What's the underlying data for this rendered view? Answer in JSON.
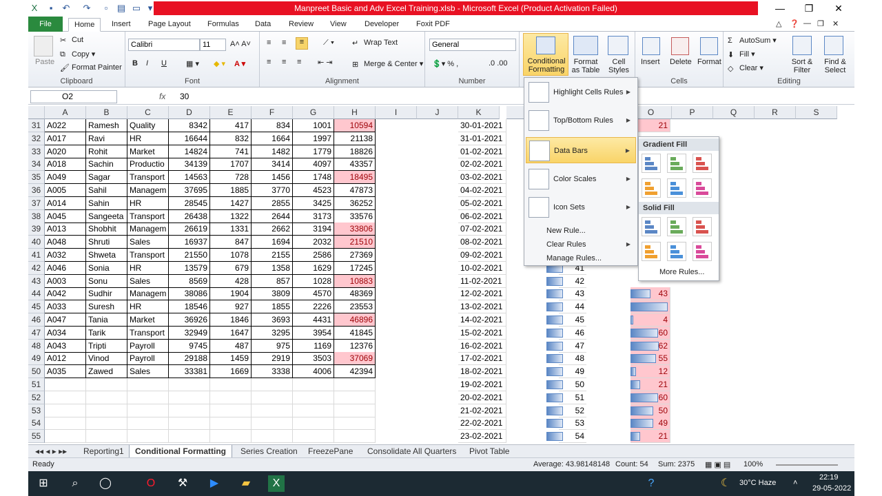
{
  "window": {
    "title": "Manpreet Basic and Adv Excel Training.xlsb - Microsoft Excel (Product Activation Failed)"
  },
  "tabs": [
    "File",
    "Home",
    "Insert",
    "Page Layout",
    "Formulas",
    "Data",
    "Review",
    "View",
    "Developer",
    "Foxit PDF"
  ],
  "ribbon": {
    "clipboard": {
      "paste": "Paste",
      "cut": "Cut",
      "copy": "Copy",
      "painter": "Format Painter",
      "label": "Clipboard"
    },
    "font": {
      "name": "Calibri",
      "size": "11",
      "label": "Font",
      "bold": "B",
      "italic": "I",
      "underline": "U"
    },
    "alignment": {
      "wrap": "Wrap Text",
      "merge": "Merge & Center",
      "label": "Alignment"
    },
    "number": {
      "format": "General",
      "label": "Number"
    },
    "styles": {
      "cf": "Conditional Formatting",
      "fat": "Format as Table",
      "cs": "Cell Styles"
    },
    "cells": {
      "insert": "Insert",
      "delete": "Delete",
      "format": "Format",
      "label": "Cells"
    },
    "editing": {
      "autosum": "AutoSum",
      "fill": "Fill",
      "clear": "Clear",
      "sort": "Sort & Filter",
      "find": "Find & Select",
      "label": "Editing"
    }
  },
  "formula": {
    "namebox": "O2",
    "fx": "fx",
    "value": "30"
  },
  "columns": [
    "A",
    "B",
    "C",
    "D",
    "E",
    "F",
    "G",
    "H",
    "I",
    "J",
    "K",
    "L",
    "M",
    "N",
    "O",
    "P",
    "Q",
    "R",
    "S"
  ],
  "rows": [
    [
      "31",
      "A022",
      "Ramesh",
      "Quality",
      "8342",
      "417",
      "834",
      "1001",
      "10594",
      "30-01-2021",
      "",
      "",
      ""
    ],
    [
      "32",
      "A017",
      "Ravi",
      "HR",
      "16644",
      "832",
      "1664",
      "1997",
      "21138",
      "31-01-2021",
      "",
      "",
      ""
    ],
    [
      "33",
      "A020",
      "Rohit",
      "Market",
      "14824",
      "741",
      "1482",
      "1779",
      "18826",
      "01-02-2021",
      "",
      "",
      ""
    ],
    [
      "34",
      "A018",
      "Sachin",
      "Productio",
      "34139",
      "1707",
      "3414",
      "4097",
      "43357",
      "02-02-2021",
      "",
      "",
      ""
    ],
    [
      "35",
      "A049",
      "Sagar",
      "Transport",
      "14563",
      "728",
      "1456",
      "1748",
      "18495",
      "03-02-2021",
      "",
      "",
      ""
    ],
    [
      "36",
      "A005",
      "Sahil",
      "Managem",
      "37695",
      "1885",
      "3770",
      "4523",
      "47873",
      "04-02-2021",
      "",
      "",
      ""
    ],
    [
      "37",
      "A014",
      "Sahin",
      "HR",
      "28545",
      "1427",
      "2855",
      "3425",
      "36252",
      "05-02-2021",
      "",
      "",
      ""
    ],
    [
      "38",
      "A045",
      "Sangeeta",
      "Transport",
      "26438",
      "1322",
      "2644",
      "3173",
      "33576",
      "06-02-2021",
      "",
      "",
      ""
    ],
    [
      "39",
      "A013",
      "Shobhit",
      "Managem",
      "26619",
      "1331",
      "2662",
      "3194",
      "33806",
      "07-02-2021",
      "",
      "",
      ""
    ],
    [
      "40",
      "A048",
      "Shruti",
      "Sales",
      "16937",
      "847",
      "1694",
      "2032",
      "21510",
      "08-02-2021",
      "",
      "",
      ""
    ],
    [
      "41",
      "A032",
      "Shweta",
      "Transport",
      "21550",
      "1078",
      "2155",
      "2586",
      "27369",
      "09-02-2021",
      "",
      "",
      ""
    ],
    [
      "42",
      "A046",
      "Sonia",
      "HR",
      "13579",
      "679",
      "1358",
      "1629",
      "17245",
      "10-02-2021",
      "41",
      "",
      ""
    ],
    [
      "43",
      "A003",
      "Sonu",
      "Sales",
      "8569",
      "428",
      "857",
      "1028",
      "10883",
      "11-02-2021",
      "42",
      "",
      ""
    ],
    [
      "44",
      "A042",
      "Sudhir",
      "Managem",
      "38086",
      "1904",
      "3809",
      "4570",
      "48369",
      "12-02-2021",
      "43",
      "",
      "43"
    ],
    [
      "45",
      "A033",
      "Suresh",
      "HR",
      "18546",
      "927",
      "1855",
      "2226",
      "23553",
      "13-02-2021",
      "44",
      "",
      "81"
    ],
    [
      "46",
      "A047",
      "Tania",
      "Market",
      "36926",
      "1846",
      "3693",
      "4431",
      "46896",
      "14-02-2021",
      "45",
      "",
      "4"
    ],
    [
      "47",
      "A034",
      "Tarik",
      "Transport",
      "32949",
      "1647",
      "3295",
      "3954",
      "41845",
      "15-02-2021",
      "46",
      "",
      "60"
    ],
    [
      "48",
      "A043",
      "Tripti",
      "Payroll",
      "9745",
      "487",
      "975",
      "1169",
      "12376",
      "16-02-2021",
      "47",
      "",
      "62"
    ],
    [
      "49",
      "A012",
      "Vinod",
      "Payroll",
      "29188",
      "1459",
      "2919",
      "3503",
      "37069",
      "17-02-2021",
      "48",
      "",
      "55"
    ],
    [
      "50",
      "A035",
      "Zawed",
      "Sales",
      "33381",
      "1669",
      "3338",
      "4006",
      "42394",
      "18-02-2021",
      "49",
      "",
      "12"
    ],
    [
      "51",
      "",
      "",
      "",
      "",
      "",
      "",
      "",
      "",
      "19-02-2021",
      "50",
      "",
      "21"
    ],
    [
      "52",
      "",
      "",
      "",
      "",
      "",
      "",
      "",
      "",
      "20-02-2021",
      "51",
      "",
      "60"
    ],
    [
      "53",
      "",
      "",
      "",
      "",
      "",
      "",
      "",
      "",
      "21-02-2021",
      "52",
      "",
      "50"
    ],
    [
      "54",
      "",
      "",
      "",
      "",
      "",
      "",
      "",
      "",
      "22-02-2021",
      "53",
      "",
      "49"
    ],
    [
      "55",
      "",
      "",
      "",
      "",
      "",
      "",
      "",
      "",
      "23-02-2021",
      "54",
      "",
      "21"
    ]
  ],
  "o_top": "21",
  "pinkH": [
    "10594",
    "18495",
    "33806",
    "21510",
    "10883",
    "46896",
    "37069"
  ],
  "cfmenu": {
    "items": [
      "Highlight Cells Rules",
      "Top/Bottom Rules",
      "Data Bars",
      "Color Scales",
      "Icon Sets"
    ],
    "small": [
      "New Rule...",
      "Clear Rules",
      "Manage Rules..."
    ]
  },
  "submenu": {
    "gradient": "Gradient Fill",
    "solid": "Solid Fill",
    "more": "More Rules..."
  },
  "sheets": [
    "Reporting1",
    "Conditional Formatting",
    "Series Creation",
    "FreezePane",
    "Consolidate All Quarters",
    "Pivot Table"
  ],
  "status": {
    "ready": "Ready",
    "average": "Average: 43.98148148",
    "count": "Count: 54",
    "sum": "Sum: 2375",
    "zoom": "100%"
  },
  "taskbar": {
    "weather": "30°C  Haze",
    "time": "22:19",
    "date": "29-05-2022"
  }
}
